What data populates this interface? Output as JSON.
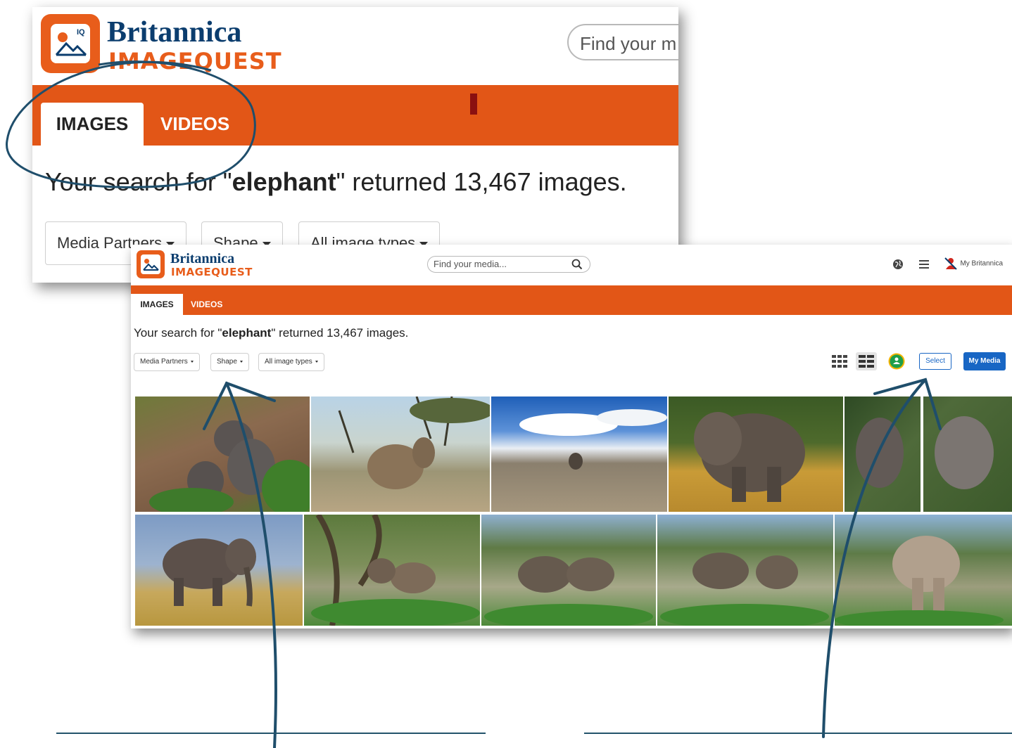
{
  "brand": {
    "title": "Britannica",
    "subtitle": "IMAGEQUEST",
    "badge": "IQ"
  },
  "search": {
    "placeholder": "Find your media...",
    "zoom_visible_text": "Find your m"
  },
  "tabs": [
    {
      "label": "IMAGES",
      "active": true
    },
    {
      "label": "VIDEOS",
      "active": false
    }
  ],
  "result": {
    "prefix": "Your search for \"",
    "query": "elephant",
    "suffix": "\" returned 13,467 images."
  },
  "filters": [
    {
      "label": "Media Partners"
    },
    {
      "label": "Shape"
    },
    {
      "label": "All image types"
    }
  ],
  "header_right": {
    "my_account": "My Britannica"
  },
  "toolbar": {
    "select_label": "Select",
    "my_media_label": "My Media"
  },
  "colors": {
    "orange": "#e25617",
    "brand_blue": "#0b3d6e",
    "action_blue": "#1866c4",
    "annotation": "#1f4e6b"
  },
  "icons": [
    "globe-icon",
    "menu-icon",
    "user-icon",
    "grid-small-icon",
    "grid-large-icon",
    "google-classroom-icon",
    "search-icon",
    "image-logo-icon"
  ]
}
